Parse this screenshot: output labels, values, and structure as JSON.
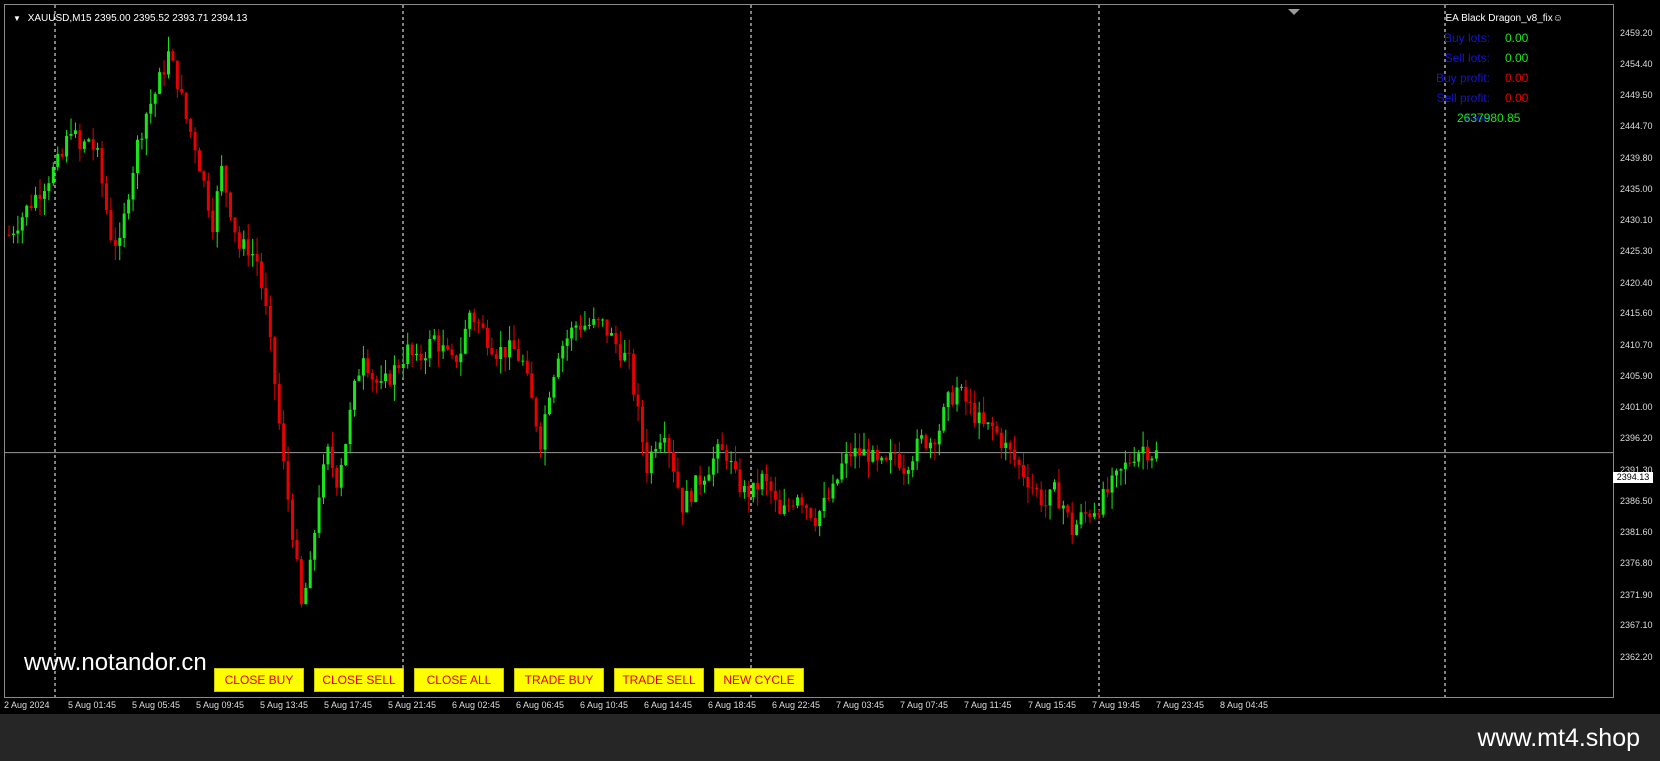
{
  "chart_header": {
    "symbol_timeframe": "XAUUSD,M15",
    "ohlc": "2395.00 2395.52 2393.71 2394.13"
  },
  "ea_name": "EA Black Dragon_v8_fix☺",
  "info_panel": [
    {
      "label": "Buy lots:",
      "value": "0.00",
      "color": "#19e619"
    },
    {
      "label": "Sell lots:",
      "value": "0.00",
      "color": "#19e619"
    },
    {
      "label": "Buy profit:",
      "value": "0.00",
      "color": "#e60000"
    },
    {
      "label": "Sell profit:",
      "value": "0.00",
      "color": "#e60000"
    },
    {
      "label": "Free",
      "value": "2637980.85",
      "color": "#19e619"
    }
  ],
  "buttons": [
    "CLOSE BUY",
    "CLOSE SELL",
    "CLOSE ALL",
    "TRADE BUY",
    "TRADE SELL",
    "NEW CYCLE"
  ],
  "watermark_left": "www.notandor.cn",
  "watermark_footer": "www.mt4.shop",
  "current_price_label": "2394.13",
  "colors": {
    "bull": "#19e619",
    "bear": "#e60000",
    "grid": "#ffffff",
    "background": "#000000",
    "button": "#ffff00"
  },
  "chart_data": {
    "type": "candlestick",
    "symbol": "XAUUSD",
    "timeframe": "M15",
    "ylim": [
      2362.2,
      2459.2
    ],
    "y_ticks": [
      "2459.20",
      "2454.40",
      "2449.50",
      "2444.70",
      "2439.80",
      "2435.00",
      "2430.10",
      "2425.30",
      "2420.40",
      "2415.60",
      "2410.70",
      "2405.90",
      "2401.00",
      "2396.20",
      "2391.30",
      "2386.50",
      "2381.60",
      "2376.80",
      "2371.90",
      "2367.10",
      "2362.20"
    ],
    "x_ticks": [
      "2 Aug 2024",
      "5 Aug 01:45",
      "5 Aug 05:45",
      "5 Aug 09:45",
      "5 Aug 13:45",
      "5 Aug 17:45",
      "5 Aug 21:45",
      "6 Aug 02:45",
      "6 Aug 06:45",
      "6 Aug 10:45",
      "6 Aug 14:45",
      "6 Aug 18:45",
      "6 Aug 22:45",
      "7 Aug 03:45",
      "7 Aug 07:45",
      "7 Aug 11:45",
      "7 Aug 15:45",
      "7 Aug 19:45",
      "7 Aug 23:45",
      "8 Aug 04:45"
    ],
    "current_price": 2394.13,
    "close_path": [
      [
        0,
        2428
      ],
      [
        4,
        2432
      ],
      [
        8,
        2436
      ],
      [
        12,
        2440
      ],
      [
        14,
        2445
      ],
      [
        16,
        2441
      ],
      [
        18,
        2443
      ],
      [
        20,
        2440
      ],
      [
        23,
        2428
      ],
      [
        25,
        2426
      ],
      [
        27,
        2435
      ],
      [
        29,
        2442
      ],
      [
        31,
        2447
      ],
      [
        33,
        2450
      ],
      [
        36,
        2456
      ],
      [
        38,
        2452
      ],
      [
        40,
        2446
      ],
      [
        42,
        2442
      ],
      [
        44,
        2436
      ],
      [
        46,
        2430
      ],
      [
        48,
        2438
      ],
      [
        50,
        2432
      ],
      [
        52,
        2426
      ],
      [
        54,
        2426
      ],
      [
        56,
        2424
      ],
      [
        58,
        2416
      ],
      [
        60,
        2405
      ],
      [
        62,
        2392
      ],
      [
        64,
        2382
      ],
      [
        66,
        2370
      ],
      [
        68,
        2376
      ],
      [
        70,
        2388
      ],
      [
        72,
        2394
      ],
      [
        74,
        2390
      ],
      [
        76,
        2396
      ],
      [
        78,
        2404
      ],
      [
        80,
        2410
      ],
      [
        82,
        2406
      ],
      [
        84,
        2404
      ],
      [
        86,
        2406
      ],
      [
        88,
        2408
      ],
      [
        90,
        2410
      ],
      [
        92,
        2408
      ],
      [
        94,
        2410
      ],
      [
        96,
        2412
      ],
      [
        98,
        2410
      ],
      [
        100,
        2408
      ],
      [
        102,
        2410
      ],
      [
        104,
        2416
      ],
      [
        106,
        2414
      ],
      [
        108,
        2412
      ],
      [
        110,
        2410
      ],
      [
        112,
        2410
      ],
      [
        114,
        2410
      ],
      [
        116,
        2408
      ],
      [
        118,
        2402
      ],
      [
        120,
        2396
      ],
      [
        122,
        2404
      ],
      [
        124,
        2410
      ],
      [
        126,
        2412
      ],
      [
        128,
        2414
      ],
      [
        130,
        2414
      ],
      [
        132,
        2414
      ],
      [
        134,
        2414
      ],
      [
        136,
        2412
      ],
      [
        138,
        2410
      ],
      [
        140,
        2408
      ],
      [
        142,
        2400
      ],
      [
        144,
        2392
      ],
      [
        146,
        2396
      ],
      [
        148,
        2398
      ],
      [
        150,
        2392
      ],
      [
        152,
        2386
      ],
      [
        154,
        2388
      ],
      [
        156,
        2390
      ],
      [
        158,
        2392
      ],
      [
        160,
        2394
      ],
      [
        162,
        2394
      ],
      [
        164,
        2390
      ],
      [
        166,
        2388
      ],
      [
        168,
        2388
      ],
      [
        170,
        2390
      ],
      [
        172,
        2388
      ],
      [
        174,
        2384
      ],
      [
        176,
        2386
      ],
      [
        178,
        2388
      ],
      [
        180,
        2386
      ],
      [
        182,
        2384
      ],
      [
        184,
        2386
      ],
      [
        186,
        2388
      ],
      [
        188,
        2392
      ],
      [
        190,
        2394
      ],
      [
        192,
        2394
      ],
      [
        194,
        2394
      ],
      [
        196,
        2392
      ],
      [
        198,
        2392
      ],
      [
        200,
        2394
      ],
      [
        202,
        2392
      ],
      [
        204,
        2394
      ],
      [
        206,
        2396
      ],
      [
        208,
        2396
      ],
      [
        210,
        2398
      ],
      [
        212,
        2402
      ],
      [
        214,
        2404
      ],
      [
        216,
        2402
      ],
      [
        218,
        2400
      ],
      [
        220,
        2398
      ],
      [
        222,
        2398
      ],
      [
        224,
        2396
      ],
      [
        226,
        2394
      ],
      [
        228,
        2392
      ],
      [
        230,
        2390
      ],
      [
        232,
        2388
      ],
      [
        234,
        2386
      ],
      [
        236,
        2388
      ],
      [
        238,
        2386
      ],
      [
        240,
        2382
      ],
      [
        242,
        2384
      ],
      [
        244,
        2385
      ],
      [
        246,
        2386
      ],
      [
        248,
        2388
      ],
      [
        250,
        2390
      ],
      [
        252,
        2392
      ],
      [
        254,
        2394
      ],
      [
        256,
        2395
      ],
      [
        258,
        2394
      ]
    ],
    "total_bars": 260
  }
}
